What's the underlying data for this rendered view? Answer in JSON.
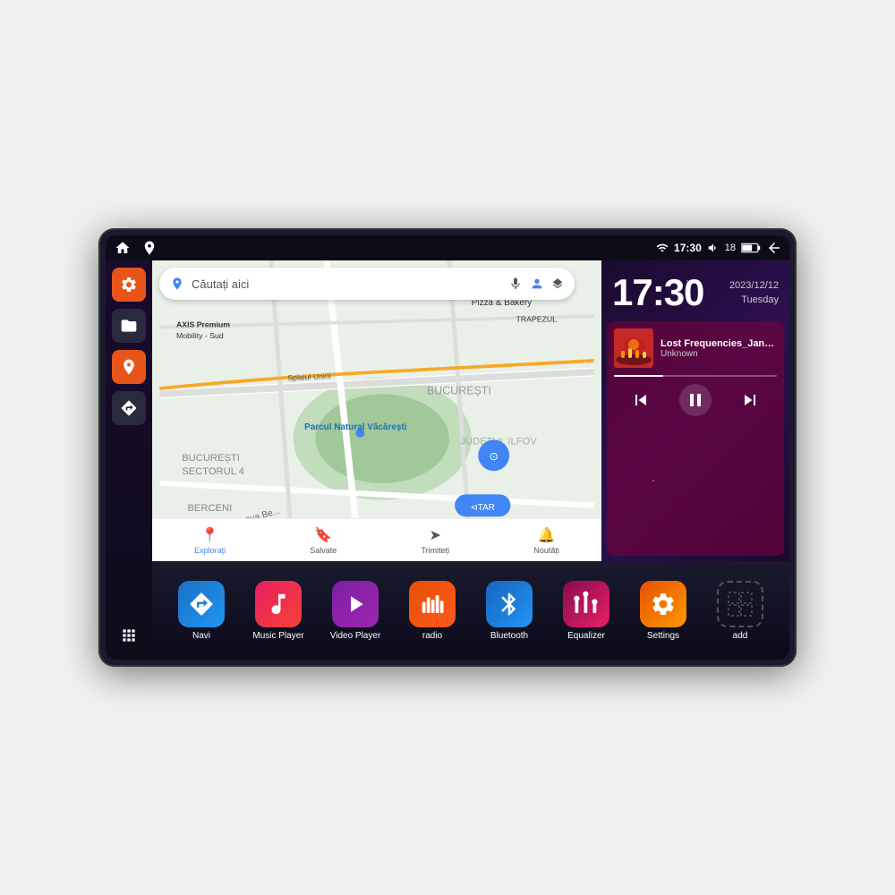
{
  "device": {
    "status_bar": {
      "left_icons": [
        "home",
        "maps"
      ],
      "time": "17:30",
      "right_icons": [
        "wifi",
        "volume",
        "battery",
        "back"
      ],
      "signal": "18"
    },
    "clock": {
      "time": "17:30",
      "date": "2023/12/12",
      "day": "Tuesday"
    },
    "map": {
      "search_placeholder": "Căutați aici",
      "locations": [
        "AXIS Premium Mobility - Sud",
        "Parcul Natural Văcărești",
        "Pizza & Bakery",
        "TRAPEZUL",
        "BUCUREȘTI",
        "BUCUREȘTI SECTORUL 4",
        "JUDEȚUL ILFOV",
        "BERCENI"
      ],
      "nav_items": [
        {
          "label": "Explorați",
          "icon": "📍",
          "active": true
        },
        {
          "label": "Salvate",
          "icon": "🔖",
          "active": false
        },
        {
          "label": "Trimiteți",
          "icon": "➤",
          "active": false
        },
        {
          "label": "Noutăți",
          "icon": "🔔",
          "active": false
        }
      ]
    },
    "music": {
      "title": "Lost Frequencies_Janie...",
      "artist": "Unknown",
      "progress": 30
    },
    "apps": [
      {
        "id": "navi",
        "label": "Navi",
        "icon": "▲",
        "color": "navi"
      },
      {
        "id": "music",
        "label": "Music Player",
        "icon": "♪",
        "color": "music"
      },
      {
        "id": "video",
        "label": "Video Player",
        "icon": "▶",
        "color": "video"
      },
      {
        "id": "radio",
        "label": "radio",
        "icon": "📻",
        "color": "radio"
      },
      {
        "id": "bluetooth",
        "label": "Bluetooth",
        "icon": "⚡",
        "color": "bluetooth"
      },
      {
        "id": "equalizer",
        "label": "Equalizer",
        "icon": "🎛",
        "color": "equalizer"
      },
      {
        "id": "settings",
        "label": "Settings",
        "icon": "⚙",
        "color": "settings"
      },
      {
        "id": "add",
        "label": "add",
        "icon": "+",
        "color": "add"
      }
    ],
    "sidebar": [
      {
        "icon": "⚙",
        "style": "orange"
      },
      {
        "icon": "📁",
        "style": "dark"
      },
      {
        "icon": "📍",
        "style": "orange"
      },
      {
        "icon": "▲",
        "style": "dark"
      },
      {
        "icon": "⋮⋮⋮",
        "style": "grid"
      }
    ]
  }
}
